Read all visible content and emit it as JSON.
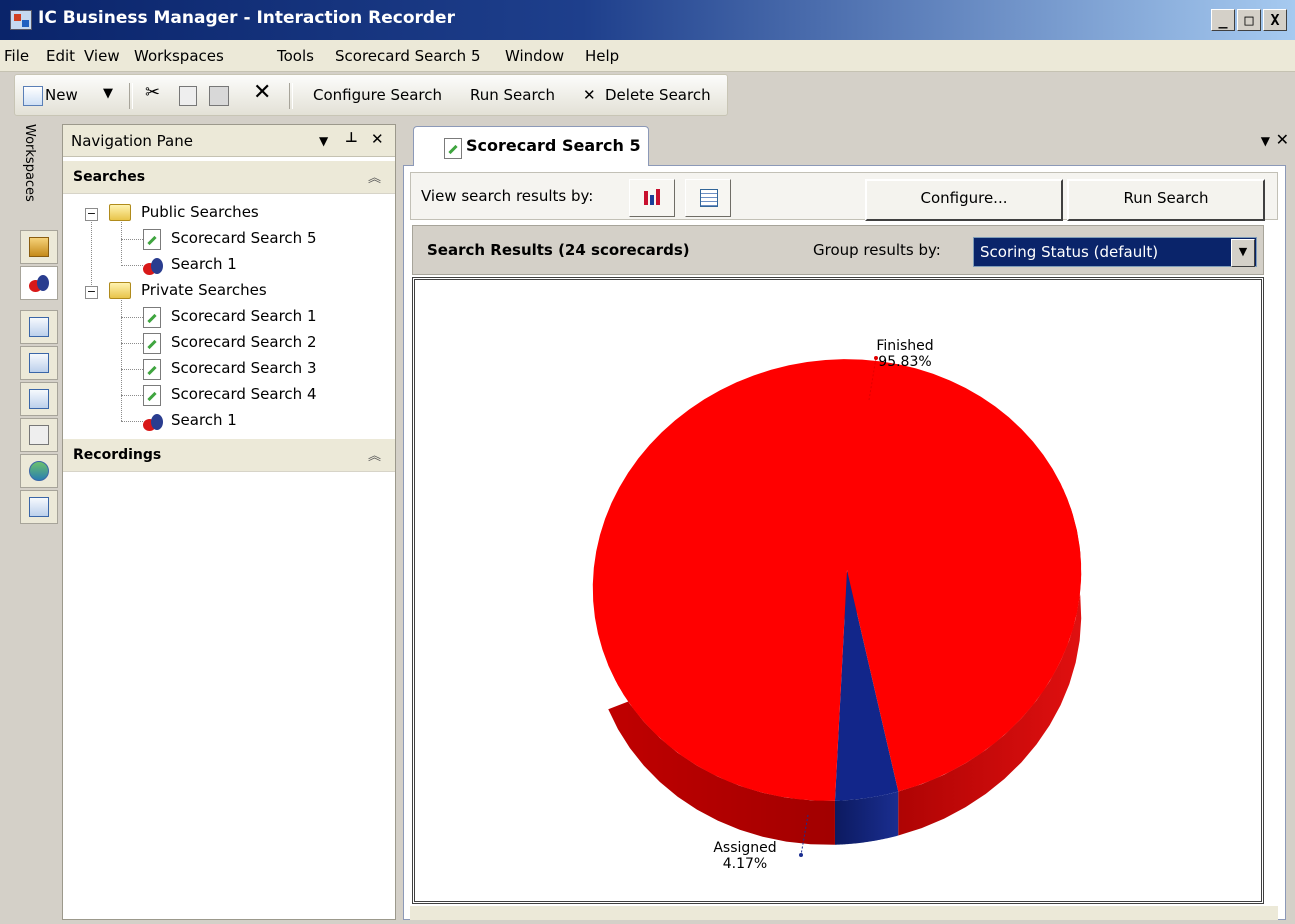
{
  "window": {
    "title": "IC Business Manager - Interaction Recorder",
    "min": "_",
    "max": "□",
    "close": "X"
  },
  "menu": [
    "File",
    "Edit",
    "View",
    "Workspaces",
    "Tools",
    "Scorecard Search 5",
    "Window",
    "Help"
  ],
  "toolbar": {
    "new_label": "New",
    "configure_label": "Configure Search",
    "run_label": "Run Search",
    "delete_label": "Delete Search"
  },
  "workspaces": {
    "label": "Workspaces"
  },
  "nav": {
    "title": "Navigation Pane",
    "searches_header": "Searches",
    "recordings_header": "Recordings",
    "public_folder": "Public Searches",
    "public_items": [
      "Scorecard Search 5",
      "Search 1"
    ],
    "private_folder": "Private Searches",
    "private_items": [
      "Scorecard Search 1",
      "Scorecard Search 2",
      "Scorecard Search 3",
      "Scorecard Search 4",
      "Search 1"
    ]
  },
  "document": {
    "tab_label": "Scorecard Search 5",
    "view_by_label": "View search results by:",
    "configure_button": "Configure...",
    "run_button": "Run Search",
    "results_title": "Search Results (24 scorecards)",
    "group_by_label": "Group results by:",
    "group_by_value": "Scoring Status (default)"
  },
  "chart_data": {
    "type": "pie",
    "slices": [
      {
        "label": "Finished",
        "value": 95.83,
        "display": "95.83%",
        "color": "#ff0000"
      },
      {
        "label": "Assigned",
        "value": 4.17,
        "display": "4.17%",
        "color": "#12268a"
      }
    ]
  }
}
